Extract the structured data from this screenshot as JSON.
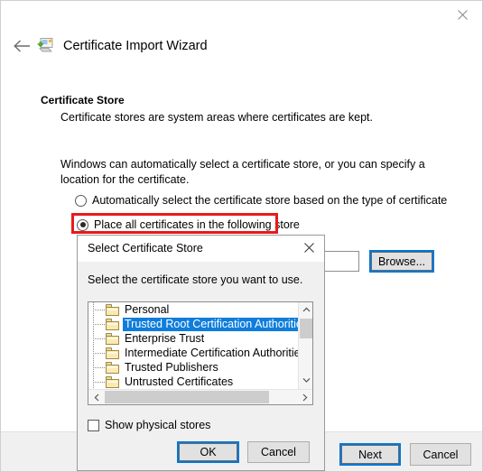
{
  "window": {
    "title": "Certificate Import Wizard",
    "close_icon": "close-icon",
    "back_icon": "back-arrow-icon",
    "app_icon": "certificate-import-icon"
  },
  "page": {
    "heading": "Certificate Store",
    "subheading": "Certificate stores are system areas where certificates are kept.",
    "intro": "Windows can automatically select a certificate store, or you can specify a location for the certificate.",
    "options": [
      {
        "label": "Automatically select the certificate store based on the type of certificate",
        "selected": false
      },
      {
        "label": "Place all certificates in the following store",
        "selected": true,
        "highlighted": true
      }
    ],
    "store_textbox_value": "",
    "browse_label": "Browse..."
  },
  "footer": {
    "next_label": "Next",
    "cancel_label": "Cancel"
  },
  "dialog": {
    "title": "Select Certificate Store",
    "close_icon": "close-icon",
    "prompt": "Select the certificate store you want to use.",
    "stores": [
      {
        "label": "Personal",
        "selected": false
      },
      {
        "label": "Trusted Root Certification Authorities",
        "selected": true
      },
      {
        "label": "Enterprise Trust",
        "selected": false
      },
      {
        "label": "Intermediate Certification Authorities",
        "selected": false
      },
      {
        "label": "Trusted Publishers",
        "selected": false
      },
      {
        "label": "Untrusted Certificates",
        "selected": false
      }
    ],
    "show_physical_label": "Show physical stores",
    "show_physical_checked": false,
    "ok_label": "OK",
    "cancel_label": "Cancel"
  },
  "colors": {
    "accent": "#0078d7",
    "selection": "#0f7ddb",
    "highlight_annotation": "#e8191b",
    "dialog_background": "#f0f0f0",
    "folder": "#fbe9b3"
  }
}
